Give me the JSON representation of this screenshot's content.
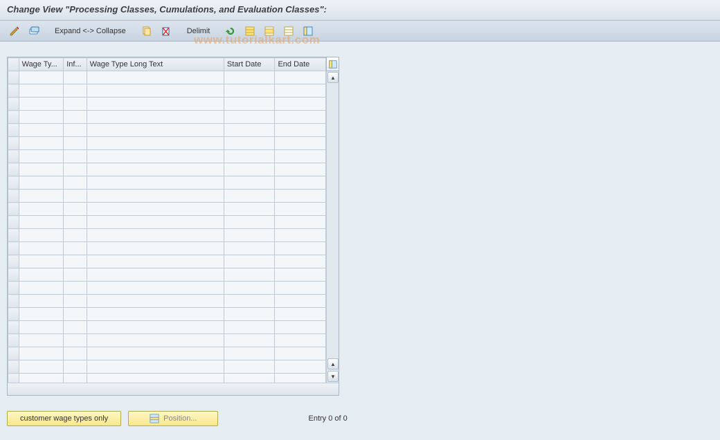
{
  "title": "Change View \"Processing Classes, Cumulations, and Evaluation Classes\":",
  "toolbar": {
    "expand_collapse_label": "Expand <-> Collapse",
    "delimit_label": "Delimit"
  },
  "grid": {
    "columns": {
      "wage_type": "Wage Ty...",
      "inf": "Inf...",
      "long_text": "Wage Type Long Text",
      "start_date": "Start Date",
      "end_date": "End Date"
    },
    "row_count": 24,
    "rows": []
  },
  "footer": {
    "customer_btn": "customer wage types only",
    "position_btn": "Position...",
    "entry_text": "Entry 0 of 0"
  },
  "watermark": "www.tutorialkart.com"
}
